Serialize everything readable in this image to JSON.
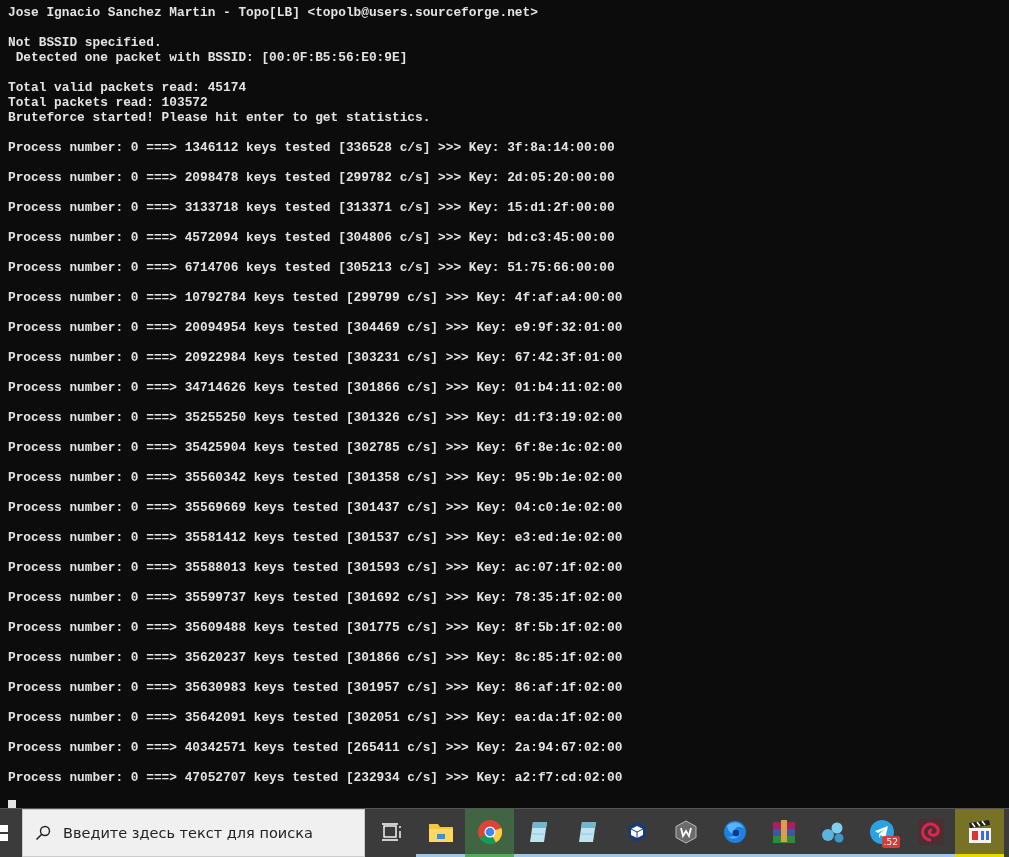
{
  "terminal": {
    "blocks": [
      {
        "lines": [
          "Jose Ignacio Sanchez Martin - Topo[LB] <topolb@users.sourceforge.net>"
        ]
      },
      {
        "lines": [
          "Not BSSID specified.",
          " Detected one packet with BSSID: [00:0F:B5:56:E0:9E]"
        ]
      },
      {
        "lines": [
          "Total valid packets read: 45174",
          "Total packets read: 103572",
          "Bruteforce started! Please hit enter to get statistics."
        ]
      },
      {
        "lines": [
          "Process number: 0 ===> 1346112 keys tested [336528 c/s] >>> Key: 3f:8a:14:00:00"
        ]
      },
      {
        "lines": [
          "Process number: 0 ===> 2098478 keys tested [299782 c/s] >>> Key: 2d:05:20:00:00"
        ]
      },
      {
        "lines": [
          "Process number: 0 ===> 3133718 keys tested [313371 c/s] >>> Key: 15:d1:2f:00:00"
        ]
      },
      {
        "lines": [
          "Process number: 0 ===> 4572094 keys tested [304806 c/s] >>> Key: bd:c3:45:00:00"
        ]
      },
      {
        "lines": [
          "Process number: 0 ===> 6714706 keys tested [305213 c/s] >>> Key: 51:75:66:00:00"
        ]
      },
      {
        "lines": [
          "Process number: 0 ===> 10792784 keys tested [299799 c/s] >>> Key: 4f:af:a4:00:00"
        ]
      },
      {
        "lines": [
          "Process number: 0 ===> 20094954 keys tested [304469 c/s] >>> Key: e9:9f:32:01:00"
        ]
      },
      {
        "lines": [
          "Process number: 0 ===> 20922984 keys tested [303231 c/s] >>> Key: 67:42:3f:01:00"
        ]
      },
      {
        "lines": [
          "Process number: 0 ===> 34714626 keys tested [301866 c/s] >>> Key: 01:b4:11:02:00"
        ]
      },
      {
        "lines": [
          "Process number: 0 ===> 35255250 keys tested [301326 c/s] >>> Key: d1:f3:19:02:00"
        ]
      },
      {
        "lines": [
          "Process number: 0 ===> 35425904 keys tested [302785 c/s] >>> Key: 6f:8e:1c:02:00"
        ]
      },
      {
        "lines": [
          "Process number: 0 ===> 35560342 keys tested [301358 c/s] >>> Key: 95:9b:1e:02:00"
        ]
      },
      {
        "lines": [
          "Process number: 0 ===> 35569669 keys tested [301437 c/s] >>> Key: 04:c0:1e:02:00"
        ]
      },
      {
        "lines": [
          "Process number: 0 ===> 35581412 keys tested [301537 c/s] >>> Key: e3:ed:1e:02:00"
        ]
      },
      {
        "lines": [
          "Process number: 0 ===> 35588013 keys tested [301593 c/s] >>> Key: ac:07:1f:02:00"
        ]
      },
      {
        "lines": [
          "Process number: 0 ===> 35599737 keys tested [301692 c/s] >>> Key: 78:35:1f:02:00"
        ]
      },
      {
        "lines": [
          "Process number: 0 ===> 35609488 keys tested [301775 c/s] >>> Key: 8f:5b:1f:02:00"
        ]
      },
      {
        "lines": [
          "Process number: 0 ===> 35620237 keys tested [301866 c/s] >>> Key: 8c:85:1f:02:00"
        ]
      },
      {
        "lines": [
          "Process number: 0 ===> 35630983 keys tested [301957 c/s] >>> Key: 86:af:1f:02:00"
        ]
      },
      {
        "lines": [
          "Process number: 0 ===> 35642091 keys tested [302051 c/s] >>> Key: ea:da:1f:02:00"
        ]
      },
      {
        "lines": [
          "Process number: 0 ===> 40342571 keys tested [265411 c/s] >>> Key: 2a:94:67:02:00"
        ]
      },
      {
        "lines": [
          "Process number: 0 ===> 47052707 keys tested [232934 c/s] >>> Key: a2:f7:cd:02:00"
        ]
      }
    ]
  },
  "taskbar": {
    "search": {
      "placeholder": "Введите здесь текст для поиска"
    },
    "apps": [
      {
        "kind": "taskview",
        "running": false,
        "highlighted": false
      },
      {
        "kind": "folder",
        "running": true,
        "highlighted": false,
        "color": "#99c9f0"
      },
      {
        "kind": "browser",
        "running": true,
        "highlighted": true,
        "color": "#4caf50"
      },
      {
        "kind": "notepad",
        "running": true,
        "highlighted": false,
        "color": "#99c9f0"
      },
      {
        "kind": "notepad",
        "running": true,
        "highlighted": false,
        "color": "#99c9f0"
      },
      {
        "kind": "cube",
        "running": true,
        "highlighted": false,
        "color": "#99c9f0"
      },
      {
        "kind": "hexagon",
        "running": true,
        "highlighted": false,
        "color": "#99c9f0"
      },
      {
        "kind": "globe",
        "running": true,
        "highlighted": false,
        "color": "#99c9f0"
      },
      {
        "kind": "books",
        "running": true,
        "highlighted": false,
        "color": "#99c9f0"
      },
      {
        "kind": "bubbles",
        "running": true,
        "highlighted": false,
        "color": "#99c9f0"
      },
      {
        "kind": "plane",
        "running": true,
        "highlighted": false,
        "color": "#99c9f0",
        "badge": ".52"
      },
      {
        "kind": "swirl",
        "running": true,
        "highlighted": false,
        "color": "#99c9f0"
      },
      {
        "kind": "clapper",
        "running": true,
        "highlighted": true,
        "color": "#e6d800"
      }
    ]
  }
}
